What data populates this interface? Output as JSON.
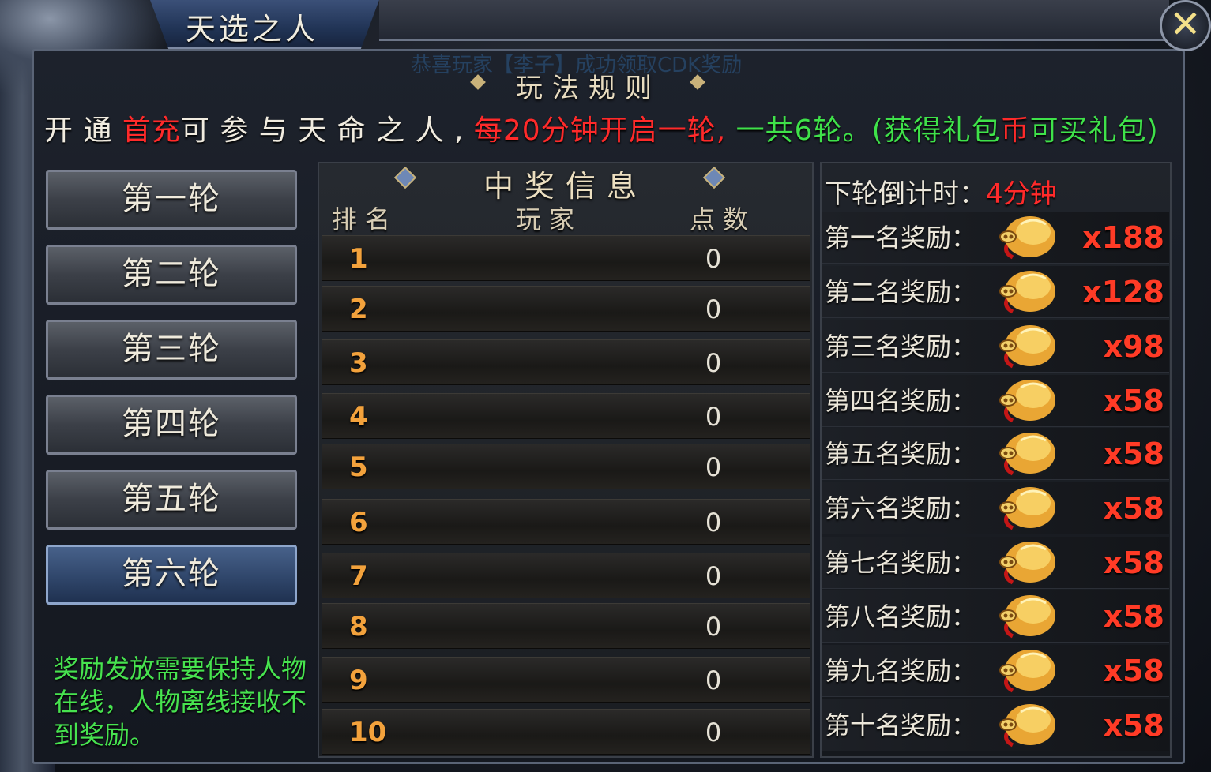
{
  "window": {
    "title": "天选之人",
    "close_label": "✕"
  },
  "marquee": "恭喜玩家【李子】成功领取CDK奖励",
  "rules": {
    "title": "玩法规则",
    "line_parts": [
      {
        "text": "开 通 ",
        "color": "white"
      },
      {
        "text": "首充",
        "color": "red"
      },
      {
        "text": "可 参 与 天 命 之 人 , ",
        "color": "white"
      },
      {
        "text": "每20分钟开启一轮,",
        "color": "red"
      },
      {
        "text": " 一共6轮。(获得礼包",
        "color": "green"
      },
      {
        "text": "币",
        "color": "red"
      },
      {
        "text": "可买礼包)",
        "color": "green"
      }
    ]
  },
  "rounds": [
    "第一轮",
    "第二轮",
    "第三轮",
    "第四轮",
    "第五轮",
    "第六轮"
  ],
  "active_round_index": 5,
  "note": "奖励发放需要保持人物在线，人物离线接收不到奖励。",
  "winners": {
    "title": "中奖信息",
    "headers": {
      "rank": "排名",
      "player": "玩家",
      "points": "点数"
    },
    "rows": [
      {
        "rank": "1",
        "player": "",
        "points": "0"
      },
      {
        "rank": "2",
        "player": "",
        "points": "0"
      },
      {
        "rank": "3",
        "player": "",
        "points": "0"
      },
      {
        "rank": "4",
        "player": "",
        "points": "0"
      },
      {
        "rank": "5",
        "player": "",
        "points": "0"
      },
      {
        "rank": "6",
        "player": "",
        "points": "0"
      },
      {
        "rank": "7",
        "player": "",
        "points": "0"
      },
      {
        "rank": "8",
        "player": "",
        "points": "0"
      },
      {
        "rank": "9",
        "player": "",
        "points": "0"
      },
      {
        "rank": "10",
        "player": "",
        "points": "0"
      }
    ]
  },
  "countdown": {
    "label": "下轮倒计时：",
    "value": "4分钟"
  },
  "rewards": [
    {
      "label": "第一名奖励：",
      "icon": "gold-pouch-icon",
      "qty": "x188"
    },
    {
      "label": "第二名奖励：",
      "icon": "gold-pouch-icon",
      "qty": "x128"
    },
    {
      "label": "第三名奖励：",
      "icon": "gold-pouch-icon",
      "qty": "x98"
    },
    {
      "label": "第四名奖励：",
      "icon": "gold-pouch-icon",
      "qty": "x58"
    },
    {
      "label": "第五名奖励：",
      "icon": "gold-pouch-icon",
      "qty": "x58"
    },
    {
      "label": "第六名奖励：",
      "icon": "gold-pouch-icon",
      "qty": "x58"
    },
    {
      "label": "第七名奖励：",
      "icon": "gold-pouch-icon",
      "qty": "x58"
    },
    {
      "label": "第八名奖励：",
      "icon": "gold-pouch-icon",
      "qty": "x58"
    },
    {
      "label": "第九名奖励：",
      "icon": "gold-pouch-icon",
      "qty": "x58"
    },
    {
      "label": "第十名奖励：",
      "icon": "gold-pouch-icon",
      "qty": "x58"
    }
  ],
  "colors": {
    "red": "#ff2a2a",
    "green": "#3fe24a",
    "white": "#f1ece0",
    "rank": "#f3a23c"
  }
}
